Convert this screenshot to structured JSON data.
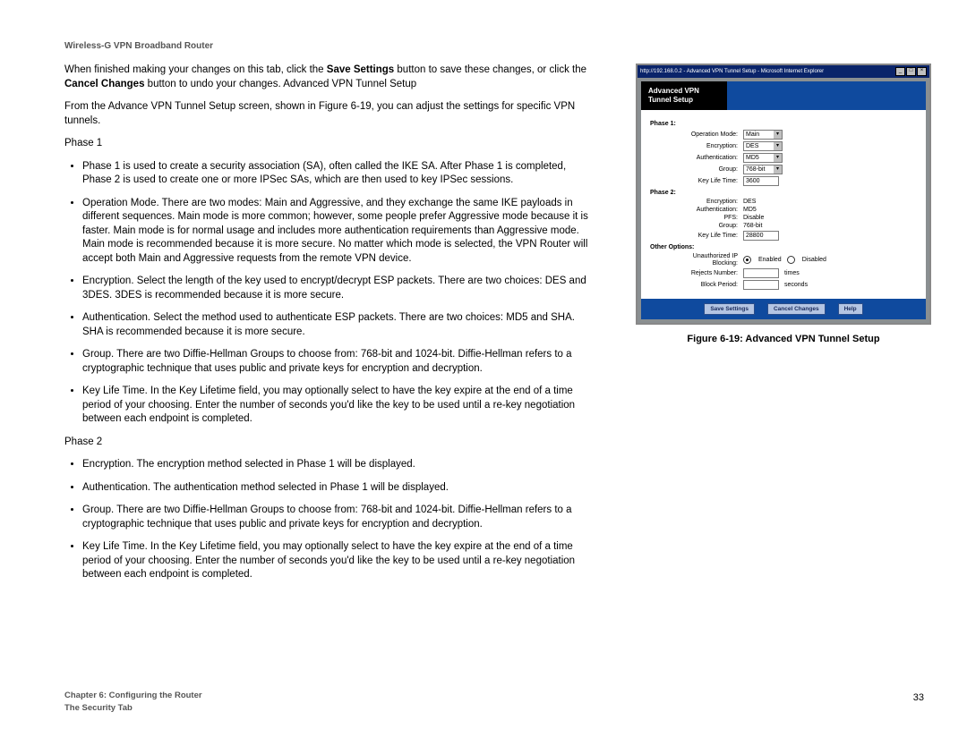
{
  "header": "Wireless-G VPN Broadband Router",
  "intro": {
    "pre1": "When finished making your changes on this tab, click the ",
    "save_bold": "Save Settings",
    "mid1": " button to save these changes, or click the ",
    "cancel_bold": "Cancel Changes",
    "post1": " button to undo your changes. Advanced VPN Tunnel Setup"
  },
  "p2": "From the Advance VPN Tunnel Setup screen, shown in Figure 6-19, you can adjust the settings for specific VPN tunnels.",
  "phase1_label": "Phase 1",
  "phase1_bullets": [
    "Phase 1 is used to create a security association (SA), often called the IKE SA. After Phase 1 is completed, Phase 2 is used to create one or more IPSec SAs, which are then used to key IPSec sessions.",
    "Operation Mode. There are two modes: Main and Aggressive, and they exchange the same IKE payloads in different sequences. Main mode is more common; however, some people prefer Aggressive mode because it is faster. Main mode is for normal usage and includes more authentication requirements than Aggressive mode. Main mode is recommended because it is more secure. No matter which mode is selected, the VPN Router will accept both Main and Aggressive requests from the remote VPN device.",
    "Encryption. Select the length of the key used to encrypt/decrypt ESP packets. There are two choices: DES and 3DES. 3DES is recommended because it is more secure.",
    "Authentication. Select the method used to authenticate ESP packets. There are two choices: MD5 and SHA. SHA is recommended because it is more secure.",
    "Group. There are two Diffie-Hellman Groups to choose from: 768-bit and 1024-bit. Diffie-Hellman refers to a cryptographic technique that uses public and private keys for encryption and decryption.",
    "Key Life Time. In the Key Lifetime field, you may optionally select to have the key expire at the end of a time period of your choosing.  Enter the number of seconds you'd like the key to be used until a re-key negotiation between each endpoint is completed."
  ],
  "phase2_label": "Phase 2",
  "phase2_bullets": [
    "Encryption. The encryption method selected in Phase 1 will be displayed.",
    "Authentication. The authentication method selected in Phase 1 will be displayed.",
    "Group. There are two Diffie-Hellman Groups to choose from: 768-bit and 1024-bit. Diffie-Hellman refers to a cryptographic technique that uses public and private keys for encryption and decryption.",
    "Key Life Time. In the Key Lifetime field, you may optionally select to have the key expire at the end of a time period of your choosing.  Enter the number of seconds you'd like the key to be used until a re-key negotiation between each endpoint is completed."
  ],
  "figure": {
    "caption": "Figure 6-19: Advanced VPN Tunnel Setup",
    "titlebar": "http://192.168.0.2 - Advanced VPN Tunnel Setup - Microsoft Internet Explorer",
    "panel_title_1": "Advanced VPN",
    "panel_title_2": "Tunnel Setup",
    "sections": {
      "phase1": "Phase 1:",
      "phase2": "Phase 2:",
      "other": "Other Options:"
    },
    "labels": {
      "op_mode": "Operation Mode:",
      "encryption": "Encryption:",
      "auth": "Authentication:",
      "group": "Group:",
      "klt": "Key Life Time:",
      "pfs": "PFS:",
      "unauth": "Unauthorized IP Blocking:",
      "rejects": "Rejects Number:",
      "block": "Block Period:"
    },
    "values": {
      "op_mode": "Main",
      "encryption1": "DES",
      "auth1": "MD5",
      "group1": "768-bit",
      "klt1": "3600",
      "encryption2": "DES",
      "auth2": "MD5",
      "pfs": "Disable",
      "group2": "768-bit",
      "klt2": "28800",
      "enabled": "Enabled",
      "disabled": "Disabled",
      "times_suffix": "times",
      "seconds_suffix": "seconds"
    },
    "buttons": {
      "save": "Save Settings",
      "cancel": "Cancel Changes",
      "help": "Help"
    }
  },
  "footer": {
    "chapter": "Chapter 6: Configuring the Router",
    "section": "The Security Tab",
    "page": "33"
  }
}
